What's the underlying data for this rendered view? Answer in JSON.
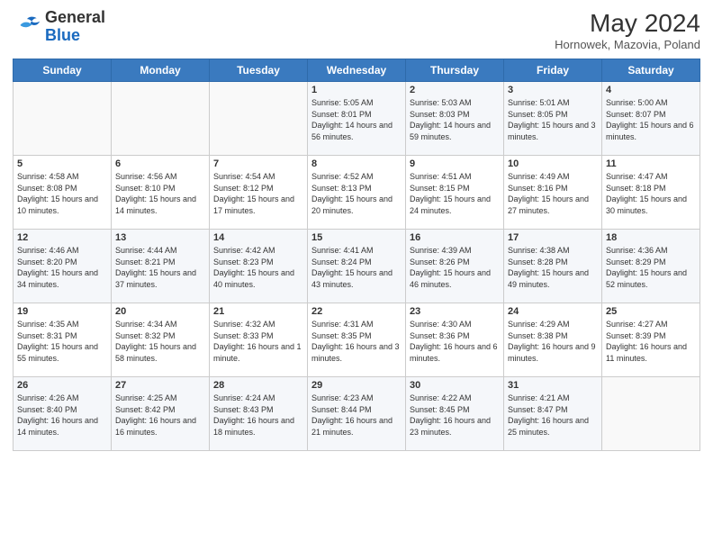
{
  "header": {
    "logo_general": "General",
    "logo_blue": "Blue",
    "title": "May 2024",
    "location": "Hornowek, Mazovia, Poland"
  },
  "weekdays": [
    "Sunday",
    "Monday",
    "Tuesday",
    "Wednesday",
    "Thursday",
    "Friday",
    "Saturday"
  ],
  "weeks": [
    [
      {
        "day": "",
        "info": ""
      },
      {
        "day": "",
        "info": ""
      },
      {
        "day": "",
        "info": ""
      },
      {
        "day": "1",
        "info": "Sunrise: 5:05 AM\nSunset: 8:01 PM\nDaylight: 14 hours and 56 minutes."
      },
      {
        "day": "2",
        "info": "Sunrise: 5:03 AM\nSunset: 8:03 PM\nDaylight: 14 hours and 59 minutes."
      },
      {
        "day": "3",
        "info": "Sunrise: 5:01 AM\nSunset: 8:05 PM\nDaylight: 15 hours and 3 minutes."
      },
      {
        "day": "4",
        "info": "Sunrise: 5:00 AM\nSunset: 8:07 PM\nDaylight: 15 hours and 6 minutes."
      }
    ],
    [
      {
        "day": "5",
        "info": "Sunrise: 4:58 AM\nSunset: 8:08 PM\nDaylight: 15 hours and 10 minutes."
      },
      {
        "day": "6",
        "info": "Sunrise: 4:56 AM\nSunset: 8:10 PM\nDaylight: 15 hours and 14 minutes."
      },
      {
        "day": "7",
        "info": "Sunrise: 4:54 AM\nSunset: 8:12 PM\nDaylight: 15 hours and 17 minutes."
      },
      {
        "day": "8",
        "info": "Sunrise: 4:52 AM\nSunset: 8:13 PM\nDaylight: 15 hours and 20 minutes."
      },
      {
        "day": "9",
        "info": "Sunrise: 4:51 AM\nSunset: 8:15 PM\nDaylight: 15 hours and 24 minutes."
      },
      {
        "day": "10",
        "info": "Sunrise: 4:49 AM\nSunset: 8:16 PM\nDaylight: 15 hours and 27 minutes."
      },
      {
        "day": "11",
        "info": "Sunrise: 4:47 AM\nSunset: 8:18 PM\nDaylight: 15 hours and 30 minutes."
      }
    ],
    [
      {
        "day": "12",
        "info": "Sunrise: 4:46 AM\nSunset: 8:20 PM\nDaylight: 15 hours and 34 minutes."
      },
      {
        "day": "13",
        "info": "Sunrise: 4:44 AM\nSunset: 8:21 PM\nDaylight: 15 hours and 37 minutes."
      },
      {
        "day": "14",
        "info": "Sunrise: 4:42 AM\nSunset: 8:23 PM\nDaylight: 15 hours and 40 minutes."
      },
      {
        "day": "15",
        "info": "Sunrise: 4:41 AM\nSunset: 8:24 PM\nDaylight: 15 hours and 43 minutes."
      },
      {
        "day": "16",
        "info": "Sunrise: 4:39 AM\nSunset: 8:26 PM\nDaylight: 15 hours and 46 minutes."
      },
      {
        "day": "17",
        "info": "Sunrise: 4:38 AM\nSunset: 8:28 PM\nDaylight: 15 hours and 49 minutes."
      },
      {
        "day": "18",
        "info": "Sunrise: 4:36 AM\nSunset: 8:29 PM\nDaylight: 15 hours and 52 minutes."
      }
    ],
    [
      {
        "day": "19",
        "info": "Sunrise: 4:35 AM\nSunset: 8:31 PM\nDaylight: 15 hours and 55 minutes."
      },
      {
        "day": "20",
        "info": "Sunrise: 4:34 AM\nSunset: 8:32 PM\nDaylight: 15 hours and 58 minutes."
      },
      {
        "day": "21",
        "info": "Sunrise: 4:32 AM\nSunset: 8:33 PM\nDaylight: 16 hours and 1 minute."
      },
      {
        "day": "22",
        "info": "Sunrise: 4:31 AM\nSunset: 8:35 PM\nDaylight: 16 hours and 3 minutes."
      },
      {
        "day": "23",
        "info": "Sunrise: 4:30 AM\nSunset: 8:36 PM\nDaylight: 16 hours and 6 minutes."
      },
      {
        "day": "24",
        "info": "Sunrise: 4:29 AM\nSunset: 8:38 PM\nDaylight: 16 hours and 9 minutes."
      },
      {
        "day": "25",
        "info": "Sunrise: 4:27 AM\nSunset: 8:39 PM\nDaylight: 16 hours and 11 minutes."
      }
    ],
    [
      {
        "day": "26",
        "info": "Sunrise: 4:26 AM\nSunset: 8:40 PM\nDaylight: 16 hours and 14 minutes."
      },
      {
        "day": "27",
        "info": "Sunrise: 4:25 AM\nSunset: 8:42 PM\nDaylight: 16 hours and 16 minutes."
      },
      {
        "day": "28",
        "info": "Sunrise: 4:24 AM\nSunset: 8:43 PM\nDaylight: 16 hours and 18 minutes."
      },
      {
        "day": "29",
        "info": "Sunrise: 4:23 AM\nSunset: 8:44 PM\nDaylight: 16 hours and 21 minutes."
      },
      {
        "day": "30",
        "info": "Sunrise: 4:22 AM\nSunset: 8:45 PM\nDaylight: 16 hours and 23 minutes."
      },
      {
        "day": "31",
        "info": "Sunrise: 4:21 AM\nSunset: 8:47 PM\nDaylight: 16 hours and 25 minutes."
      },
      {
        "day": "",
        "info": ""
      }
    ]
  ]
}
